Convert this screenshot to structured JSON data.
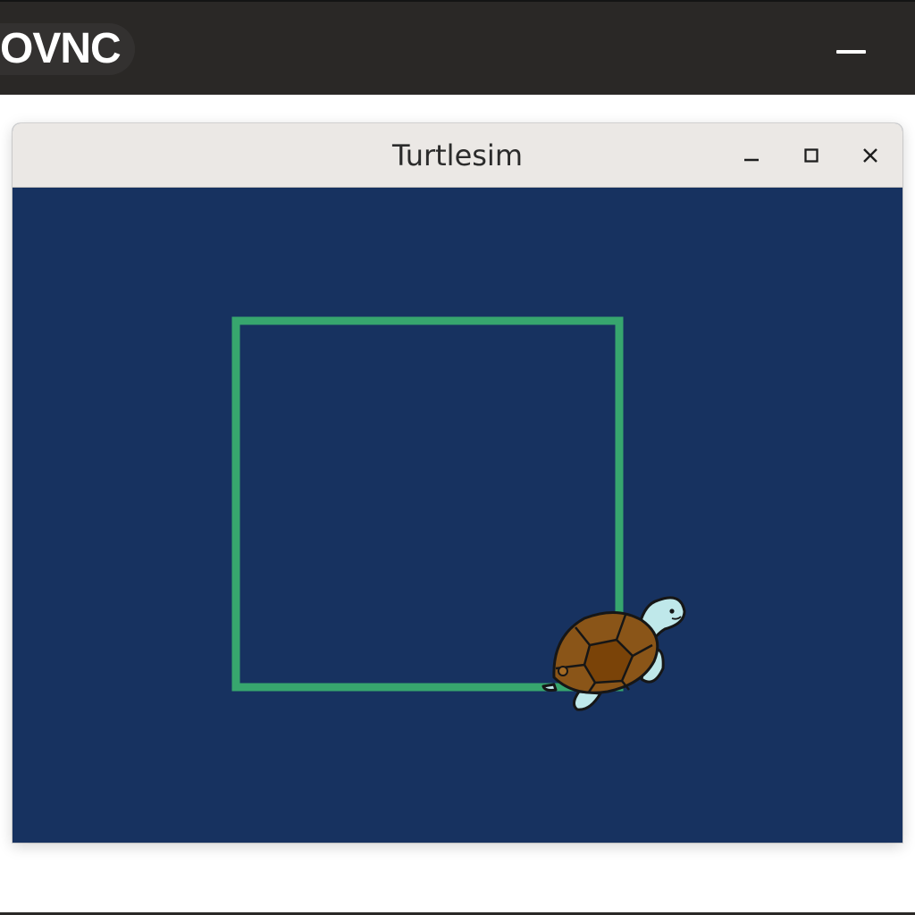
{
  "vnc_bar": {
    "logo_text": "OVNC",
    "minimize_icon": "minus-icon",
    "background": "#2a2826"
  },
  "window": {
    "title": "Turtlesim",
    "buttons": {
      "minimize_icon": "minimize-icon",
      "maximize_icon": "maximize-icon",
      "close_icon": "close-icon"
    },
    "titlebar_color": "#ebe8e5"
  },
  "canvas": {
    "background": "#173260",
    "pen_color": "#37a66e",
    "turtle_icon": "turtle-icon"
  }
}
